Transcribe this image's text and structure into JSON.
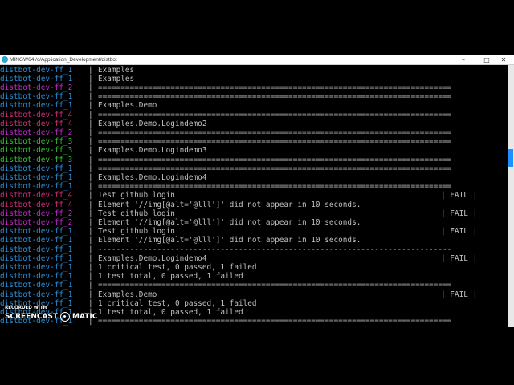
{
  "window": {
    "title": "MINGW64:/c/Application_Development/distbot",
    "minimize": "–",
    "maximize": "□",
    "close": "✕"
  },
  "colors": {
    "ff_1": "#2b8fd6",
    "ff_2": "#c12ac9",
    "ff_3": "#33c433",
    "ff_4": "#cc2f7a",
    "text": "#c0c0c0"
  },
  "lines": [
    {
      "tag": "distbot-dev-ff_1",
      "color": "#2b8fd6",
      "msg": "Examples",
      "status": ""
    },
    {
      "tag": "distbot-dev-ff_1",
      "color": "#2b8fd6",
      "msg": "Examples",
      "status": ""
    },
    {
      "tag": "distbot-dev-ff_2",
      "color": "#c12ac9",
      "msg": "==============================================================================",
      "status": ""
    },
    {
      "tag": "distbot-dev-ff_1",
      "color": "#2b8fd6",
      "msg": "==============================================================================",
      "status": ""
    },
    {
      "tag": "distbot-dev-ff_1",
      "color": "#2b8fd6",
      "msg": "Examples.Demo",
      "status": ""
    },
    {
      "tag": "distbot-dev-ff_4",
      "color": "#cc2f7a",
      "msg": "==============================================================================",
      "status": ""
    },
    {
      "tag": "distbot-dev-ff_4",
      "color": "#cc2f7a",
      "msg": "Examples.Demo.Logindemo2",
      "status": ""
    },
    {
      "tag": "distbot-dev-ff_2",
      "color": "#c12ac9",
      "msg": "==============================================================================",
      "status": ""
    },
    {
      "tag": "distbot-dev-ff_3",
      "color": "#33c433",
      "msg": "==============================================================================",
      "status": ""
    },
    {
      "tag": "distbot-dev-ff_3",
      "color": "#33c433",
      "msg": "Examples.Demo.Logindemo3",
      "status": ""
    },
    {
      "tag": "distbot-dev-ff_3",
      "color": "#33c433",
      "msg": "==============================================================================",
      "status": ""
    },
    {
      "tag": "distbot-dev-ff_1",
      "color": "#2b8fd6",
      "msg": "==============================================================================",
      "status": ""
    },
    {
      "tag": "distbot-dev-ff_1",
      "color": "#2b8fd6",
      "msg": "Examples.Demo.Logindemo4",
      "status": ""
    },
    {
      "tag": "distbot-dev-ff_1",
      "color": "#2b8fd6",
      "msg": "==============================================================================",
      "status": ""
    },
    {
      "tag": "distbot-dev-ff_4",
      "color": "#cc2f7a",
      "msg": "Test github login",
      "status": "| FAIL |"
    },
    {
      "tag": "distbot-dev-ff_4",
      "color": "#cc2f7a",
      "msg": "Element '//img[@alt='@lll']' did not appear in 10 seconds.",
      "status": ""
    },
    {
      "tag": "distbot-dev-ff_2",
      "color": "#c12ac9",
      "msg": "Test github login",
      "status": "| FAIL |"
    },
    {
      "tag": "distbot-dev-ff_2",
      "color": "#c12ac9",
      "msg": "Element '//img[@alt='@lll']' did not appear in 10 seconds.",
      "status": ""
    },
    {
      "tag": "distbot-dev-ff_1",
      "color": "#2b8fd6",
      "msg": "Test github login",
      "status": "| FAIL |"
    },
    {
      "tag": "distbot-dev-ff_1",
      "color": "#2b8fd6",
      "msg": "Element '//img[@alt='@lll']' did not appear in 10 seconds.",
      "status": ""
    },
    {
      "tag": "distbot-dev-ff_1",
      "color": "#2b8fd6",
      "msg": "------------------------------------------------------------------------------",
      "status": ""
    },
    {
      "tag": "distbot-dev-ff_1",
      "color": "#2b8fd6",
      "msg": "Examples.Demo.Logindemo4",
      "status": "| FAIL |"
    },
    {
      "tag": "distbot-dev-ff_1",
      "color": "#2b8fd6",
      "msg": "1 critical test, 0 passed, 1 failed",
      "status": ""
    },
    {
      "tag": "distbot-dev-ff_1",
      "color": "#2b8fd6",
      "msg": "1 test total, 0 passed, 1 failed",
      "status": ""
    },
    {
      "tag": "distbot-dev-ff_1",
      "color": "#2b8fd6",
      "msg": "==============================================================================",
      "status": ""
    },
    {
      "tag": "distbot-dev-ff_1",
      "color": "#2b8fd6",
      "msg": "Examples.Demo",
      "status": "| FAIL |"
    },
    {
      "tag": "distbot-dev-ff_1",
      "color": "#2b8fd6",
      "msg": "1 critical test, 0 passed, 1 failed",
      "status": ""
    },
    {
      "tag": "distbot-dev-ff_1",
      "color": "#2b8fd6",
      "msg": "1 test total, 0 passed, 1 failed",
      "status": ""
    },
    {
      "tag": "distbot-dev-ff_1",
      "color": "#2b8fd6",
      "msg": "==============================================================================",
      "status": ""
    }
  ],
  "watermark": {
    "line1": "RECORDED WITH",
    "line2a": "SCREENCAST",
    "line2b": "MATIC"
  }
}
